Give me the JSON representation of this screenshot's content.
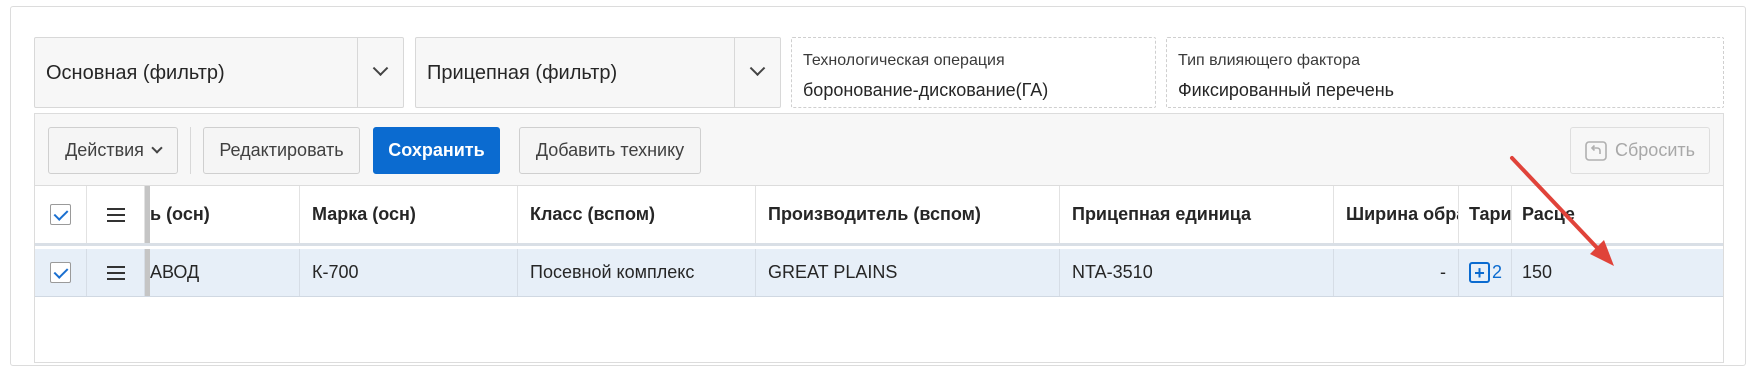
{
  "filters": {
    "main_select": "Основная (фильтр)",
    "trailer_select": "Прицепная (фильтр)",
    "operation": {
      "label": "Технологическая операция",
      "value": "боронование-дискование(ГА)"
    },
    "factor": {
      "label": "Тип влияющего фактора",
      "value": "Фиксированный перечень"
    }
  },
  "toolbar": {
    "actions": "Действия",
    "edit": "Редактировать",
    "save": "Сохранить",
    "add": "Добавить технику",
    "reset": "Сбросить"
  },
  "columns": [
    "ь (осн)",
    "Марка (осн)",
    "Класс (вспом)",
    "Производитель (вспом)",
    "Прицепная единица",
    "Ширина обраб",
    "Тариф",
    "Расце"
  ],
  "rows": [
    {
      "c0": "АВОД",
      "c1": "К-700",
      "c2": "Посевной комплекс",
      "c3": "GREAT PLAINS",
      "c4": "NTA-3510",
      "c5": "-",
      "c6": "2",
      "c7": "150"
    }
  ],
  "colors": {
    "primary": "#0b6bd0",
    "arrow": "#e0433a",
    "row_selected": "#e7eff8"
  }
}
